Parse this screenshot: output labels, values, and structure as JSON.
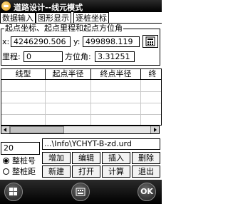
{
  "window": {
    "title": "道路设计--线元模式"
  },
  "tabs": [
    {
      "label": "数据输入",
      "active": false
    },
    {
      "label": "图形显示",
      "active": true
    },
    {
      "label": "逐桩坐标",
      "active": false
    }
  ],
  "start_group": {
    "title": "起点坐标、起点里程和起点方位角",
    "x_label": "x:",
    "x_value": "4246290.506",
    "y_label": "y:",
    "y_value": "499898.119",
    "mileage_label": "里程:",
    "mileage_value": "0",
    "azimuth_label": "方位角:",
    "azimuth_value": "3.31251",
    "calc_icon": "calculator-icon"
  },
  "table": {
    "columns": [
      "线型",
      "起点半径",
      "终点半径",
      "终"
    ],
    "rows": []
  },
  "bottom": {
    "code_value": "20",
    "file_path": "...\\Info\\YCHYT-B-zd.urd",
    "radio_pile_number": "整桩号",
    "radio_pile_distance": "整桩距",
    "buttons": {
      "add": "增加",
      "edit": "编辑",
      "insert": "插入",
      "delete": "删除",
      "new": "新建",
      "open": "打开",
      "calculate": "计算",
      "exit": "退出"
    }
  },
  "softbar": {
    "left_icon": "windows-start-icon",
    "center_icon": "keyboard-icon",
    "ok_label": "OK"
  }
}
